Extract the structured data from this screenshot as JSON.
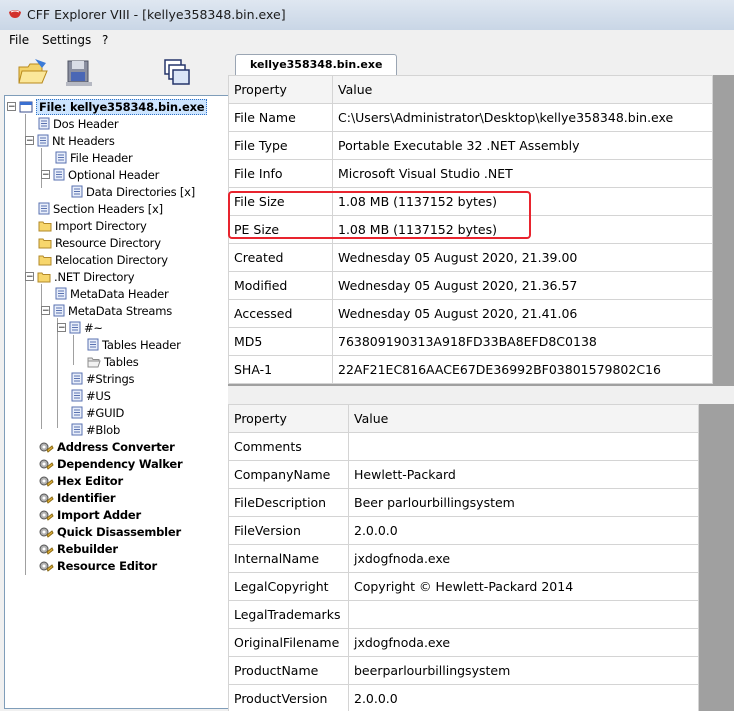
{
  "window": {
    "title": "CFF Explorer VIII - [kellye358348.bin.exe]"
  },
  "menu": {
    "items": [
      "File",
      "Settings",
      "?"
    ]
  },
  "toolbar": {
    "buttons": [
      "open-folder-icon",
      "save-disk-icon",
      "windows-icon"
    ]
  },
  "tab": {
    "label": "kellye358348.bin.exe"
  },
  "tree": {
    "root": "File: kellye358348.bin.exe",
    "dos_header": "Dos Header",
    "nt_headers": "Nt Headers",
    "file_header": "File Header",
    "optional_header": "Optional Header",
    "data_directories": "Data Directories [x]",
    "section_headers": "Section Headers [x]",
    "import_directory": "Import Directory",
    "resource_directory": "Resource Directory",
    "relocation_directory": "Relocation Directory",
    "net_directory": ".NET Directory",
    "metadata_header": "MetaData Header",
    "metadata_streams": "MetaData Streams",
    "stream_tilde": "#~",
    "tables_header": "Tables Header",
    "tables": "Tables",
    "strings": "#Strings",
    "us": "#US",
    "guid": "#GUID",
    "blob": "#Blob",
    "address_converter": "Address Converter",
    "dependency_walker": "Dependency Walker",
    "hex_editor": "Hex Editor",
    "identifier": "Identifier",
    "import_adder": "Import Adder",
    "quick_disassembler": "Quick Disassembler",
    "rebuilder": "Rebuilder",
    "resource_editor": "Resource Editor"
  },
  "file_info": {
    "headers": [
      "Property",
      "Value"
    ],
    "rows": [
      [
        "File Name",
        "C:\\Users\\Administrator\\Desktop\\kellye358348.bin.exe"
      ],
      [
        "File Type",
        "Portable Executable 32 .NET Assembly"
      ],
      [
        "File Info",
        "Microsoft Visual Studio .NET"
      ],
      [
        "File Size",
        "1.08 MB (1137152 bytes)"
      ],
      [
        "PE Size",
        "1.08 MB (1137152 bytes)"
      ],
      [
        "Created",
        "Wednesday 05 August 2020, 21.39.00"
      ],
      [
        "Modified",
        "Wednesday 05 August 2020, 21.36.57"
      ],
      [
        "Accessed",
        "Wednesday 05 August 2020, 21.41.06"
      ],
      [
        "MD5",
        "763809190313A918FD33BA8EFD8C0138"
      ],
      [
        "SHA-1",
        "22AF21EC816AACE67DE36992BF03801579802C16"
      ]
    ]
  },
  "version_info": {
    "headers": [
      "Property",
      "Value"
    ],
    "rows": [
      [
        "Comments",
        ""
      ],
      [
        "CompanyName",
        "Hewlett-Packard"
      ],
      [
        "FileDescription",
        "Beer parlourbillingsystem"
      ],
      [
        "FileVersion",
        "2.0.0.0"
      ],
      [
        "InternalName",
        "jxdogfnoda.exe"
      ],
      [
        "LegalCopyright",
        "Copyright © Hewlett-Packard 2014"
      ],
      [
        "LegalTrademarks",
        ""
      ],
      [
        "OriginalFilename",
        "jxdogfnoda.exe"
      ],
      [
        "ProductName",
        "beerparlourbillingsystem"
      ],
      [
        "ProductVersion",
        "2.0.0.0"
      ]
    ]
  },
  "colors": {
    "highlight": "#e8242e",
    "selection": "#cde5ff"
  }
}
